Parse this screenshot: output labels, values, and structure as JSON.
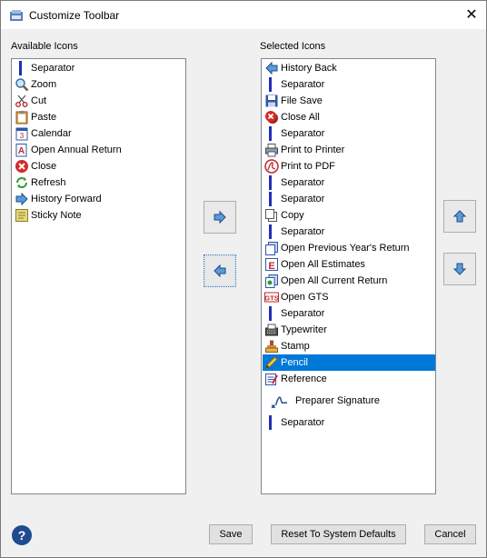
{
  "window": {
    "title": "Customize Toolbar"
  },
  "available": {
    "label": "Available Icons",
    "items": [
      {
        "label": "Separator",
        "icon": "separator-icon"
      },
      {
        "label": "Zoom",
        "icon": "zoom-icon"
      },
      {
        "label": "Cut",
        "icon": "scissors-icon"
      },
      {
        "label": "Paste",
        "icon": "clipboard-icon"
      },
      {
        "label": "Calendar",
        "icon": "calendar-icon"
      },
      {
        "label": "Open Annual Return",
        "icon": "annual-return-icon"
      },
      {
        "label": "Close",
        "icon": "close-circle-icon"
      },
      {
        "label": "Refresh",
        "icon": "refresh-icon"
      },
      {
        "label": "History Forward",
        "icon": "arrow-right-icon"
      },
      {
        "label": "Sticky Note",
        "icon": "sticky-note-icon"
      }
    ]
  },
  "selected": {
    "label": "Selected Icons",
    "items": [
      {
        "label": "History Back",
        "icon": "arrow-left-icon"
      },
      {
        "label": "Separator",
        "icon": "separator-icon"
      },
      {
        "label": "File Save",
        "icon": "floppy-icon"
      },
      {
        "label": "Close All",
        "icon": "close-all-icon"
      },
      {
        "label": "Separator",
        "icon": "separator-icon"
      },
      {
        "label": "Print to Printer",
        "icon": "printer-icon"
      },
      {
        "label": "Print to PDF",
        "icon": "pdf-icon"
      },
      {
        "label": "Separator",
        "icon": "separator-icon"
      },
      {
        "label": "Separator",
        "icon": "separator-icon"
      },
      {
        "label": "Copy",
        "icon": "copy-icon"
      },
      {
        "label": "Separator",
        "icon": "separator-icon"
      },
      {
        "label": "Open Previous Year's Return",
        "icon": "previous-year-icon"
      },
      {
        "label": "Open All Estimates",
        "icon": "estimates-icon"
      },
      {
        "label": "Open All Current Return",
        "icon": "current-return-icon"
      },
      {
        "label": "Open GTS",
        "icon": "gts-icon"
      },
      {
        "label": "Separator",
        "icon": "separator-icon"
      },
      {
        "label": "Typewriter",
        "icon": "typewriter-icon"
      },
      {
        "label": "Stamp",
        "icon": "stamp-icon"
      },
      {
        "label": "Pencil",
        "icon": "pencil-icon",
        "selected": true
      },
      {
        "label": "Reference",
        "icon": "reference-icon"
      },
      {
        "label": "Preparer Signature",
        "icon": "signature-icon"
      },
      {
        "label": "Separator",
        "icon": "separator-icon"
      }
    ]
  },
  "buttons": {
    "save": "Save",
    "reset": "Reset To System Defaults",
    "cancel": "Cancel",
    "help": "?"
  },
  "colors": {
    "selection": "#0078d7",
    "separator": "#1f2fb7"
  }
}
